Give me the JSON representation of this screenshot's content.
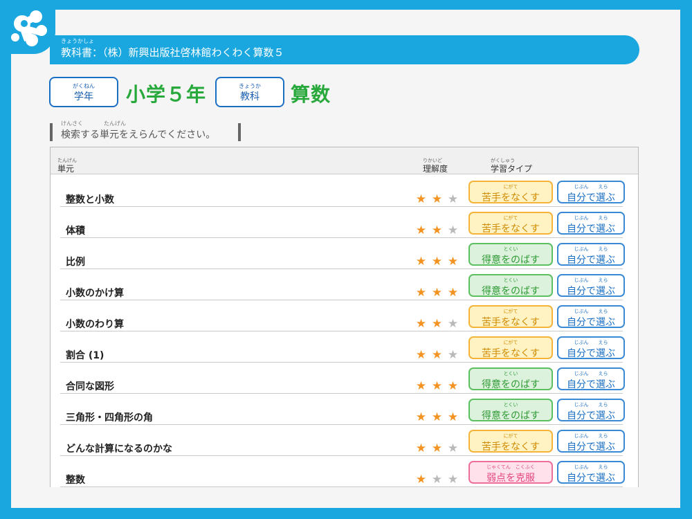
{
  "header": {
    "textbook_label": "教科書：（株）新興出版社啓林館わくわく算数５",
    "textbook_ruby": "きょうかしょ"
  },
  "grade": {
    "button_label": "学年",
    "button_ruby": "がくねん",
    "value": "小学５年"
  },
  "subject": {
    "button_label": "教科",
    "button_ruby": "きょうか",
    "value": "算数"
  },
  "search": {
    "prompt": "検索する単元をえらんでください。",
    "ruby_kensaku": "けんさく",
    "ruby_tangen": "たんげん"
  },
  "table": {
    "col_unit": "単元",
    "col_unit_ruby": "たんげん",
    "col_understanding": "理解度",
    "col_understanding_ruby": "りかいど",
    "col_type": "学習タイプ",
    "col_type_ruby": "がくしゅう"
  },
  "self_select": {
    "label": "自分で選ぶ",
    "ruby": "じぶん　　えら"
  },
  "types": {
    "nigate": {
      "label": "苦手をなくす",
      "ruby": "にがて"
    },
    "tokui": {
      "label": "得意をのばす",
      "ruby": "とくい"
    },
    "jaku": {
      "label": "弱点を克服",
      "ruby": "じゃくてん　こくふく"
    }
  },
  "rows": [
    {
      "unit": "整数と小数",
      "stars": 2,
      "type": "nigate"
    },
    {
      "unit": "体積",
      "stars": 2,
      "type": "nigate"
    },
    {
      "unit": "比例",
      "stars": 3,
      "type": "tokui"
    },
    {
      "unit": "小数のかけ算",
      "stars": 3,
      "type": "tokui"
    },
    {
      "unit": "小数のわり算",
      "stars": 2,
      "type": "nigate"
    },
    {
      "unit": "割合 (1)",
      "stars": 2,
      "type": "nigate"
    },
    {
      "unit": "合同な図形",
      "stars": 3,
      "type": "tokui"
    },
    {
      "unit": "三角形・四角形の角",
      "stars": 3,
      "type": "tokui"
    },
    {
      "unit": "どんな計算になるのかな",
      "stars": 2,
      "type": "nigate"
    },
    {
      "unit": "整数",
      "stars": 1,
      "type": "jaku"
    }
  ],
  "colors": {
    "frame": "#1aa7e0",
    "title_green": "#27a83a",
    "star_on": "#f39322",
    "star_off": "#b9b9b9"
  },
  "icons": {
    "logo": "molecule-logo-icon",
    "star": "star-icon"
  }
}
